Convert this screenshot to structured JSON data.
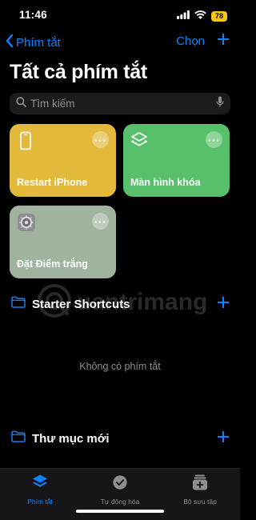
{
  "status": {
    "time": "11:46",
    "battery": "78"
  },
  "nav": {
    "back_label": "Phím tắt",
    "select_label": "Chọn"
  },
  "page": {
    "title": "Tất cả phím tắt"
  },
  "search": {
    "placeholder": "Tìm kiếm"
  },
  "shortcuts": [
    {
      "label": "Restart iPhone",
      "color": "#e2b93b",
      "icon": "iphone-icon"
    },
    {
      "label": "Màn hình khóa",
      "color": "#58c06b",
      "icon": "layers-icon"
    },
    {
      "label": "Đặt Điểm trắng",
      "color": "#9fb39f",
      "icon": "settings-gear-icon"
    }
  ],
  "folders": [
    {
      "name": "Starter Shortcuts",
      "empty_text": "Không có phím tắt"
    },
    {
      "name": "Thư mục mới"
    }
  ],
  "watermark": {
    "text": "uantrimang"
  },
  "tabbar": {
    "items": [
      {
        "label": "Phím tắt",
        "icon": "shortcuts-layers-icon",
        "active": true
      },
      {
        "label": "Tự động hóa",
        "icon": "clock-check-icon",
        "active": false
      },
      {
        "label": "Bộ sưu tập",
        "icon": "gallery-icon",
        "active": false
      }
    ]
  },
  "colors": {
    "accent": "#0a84ff",
    "background": "#000000",
    "battery": "#f5c518"
  }
}
